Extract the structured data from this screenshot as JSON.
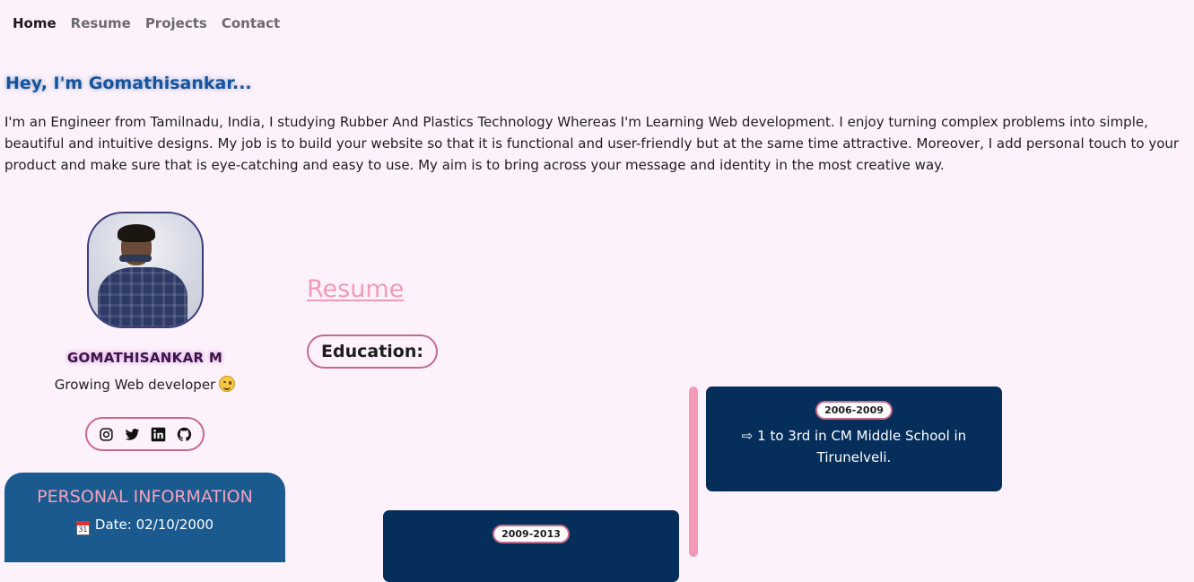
{
  "nav": {
    "items": [
      {
        "label": "Home",
        "active": true
      },
      {
        "label": "Resume",
        "active": false
      },
      {
        "label": "Projects",
        "active": false
      },
      {
        "label": "Contact",
        "active": false
      }
    ]
  },
  "intro": {
    "greeting": "Hey, I'm Gomathisankar...",
    "paragraph": "I'm an Engineer from Tamilnadu, India, I studying Rubber And Plastics Technology Whereas I'm Learning Web development. I enjoy turning complex problems into simple, beautiful and intuitive designs. My job is to build your website so that it is functional and user-friendly but at the same time attractive. Moreover, I add personal touch to your product and make sure that is eye-catching and easy to use. My aim is to bring across your message and identity in the most creative way."
  },
  "profile": {
    "name": "GOMATHISANKAR M",
    "role": "Growing Web developer",
    "socials": [
      "instagram-icon",
      "twitter-icon",
      "linkedin-icon",
      "github-icon"
    ]
  },
  "personal_info": {
    "title": "PERSONAL INFORMATION",
    "date": "Date: 02/10/2000"
  },
  "resume": {
    "title": "Resume",
    "education_label": "Education:",
    "timeline": [
      {
        "years": "2006-2009",
        "text": "⇨ 1 to 3rd in CM Middle School in Tirunelveli."
      },
      {
        "years": "2009-2013",
        "text": ""
      }
    ]
  },
  "colors": {
    "background": "#fdf2fb",
    "accent_pink": "#f39ab6",
    "navy_card": "#052e5b",
    "info_blue": "#1a5a8e",
    "greeting_blue": "#15539c"
  }
}
